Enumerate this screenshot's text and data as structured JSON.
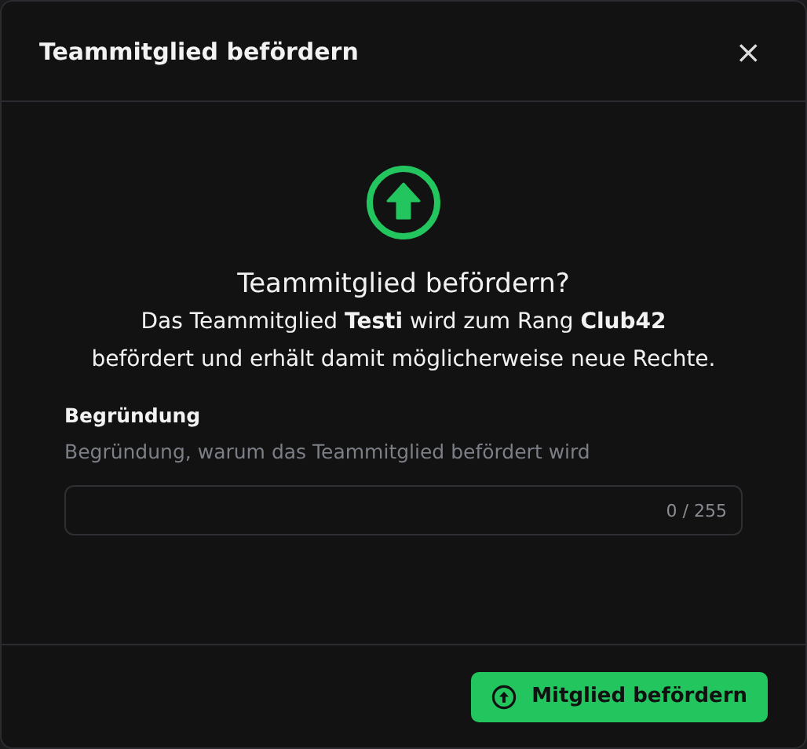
{
  "dialog": {
    "title": "Teammitglied befördern",
    "close": "×"
  },
  "confirm": {
    "heading": "Teammitglied befördern?",
    "message": "Das Teammitglied **Testi** wird zum Rang **Club42** befördert und erhält damit möglicherweise neue Rechte."
  },
  "reason": {
    "label": "Begründung",
    "description": "Begründung, warum das Teammitglied befördert wird",
    "counter": "0 / 255"
  },
  "buttons": [
    {
      "label": "Mitglied befördern"
    }
  ]
}
